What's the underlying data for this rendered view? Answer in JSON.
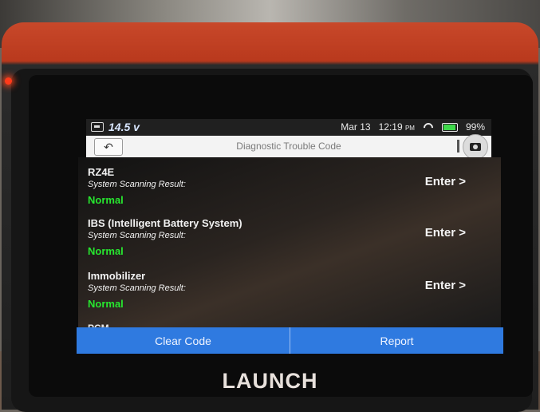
{
  "status_bar": {
    "voltage": "14.5 v",
    "date": "Mar 13",
    "time": "12:19",
    "ampm": "PM",
    "battery": "99%"
  },
  "header": {
    "title": "Diagnostic Trouble Code"
  },
  "modules": [
    {
      "name": "RZ4E",
      "result_label": "System Scanning Result:",
      "status": "Normal",
      "enter_label": "Enter >"
    },
    {
      "name": "IBS (Intelligent Battery System)",
      "result_label": "System Scanning Result:",
      "status": "Normal",
      "enter_label": "Enter >"
    },
    {
      "name": "Immobilizer",
      "result_label": "System Scanning Result:",
      "status": "Normal",
      "enter_label": "Enter >"
    }
  ],
  "partial_module": "PCM",
  "actions": {
    "clear_code": "Clear Code",
    "report": "Report"
  },
  "brand": "LAUNCH",
  "colors": {
    "accent_blue": "#2f7ae0",
    "status_green": "#27e62f",
    "housing_orange": "#c8482a"
  }
}
